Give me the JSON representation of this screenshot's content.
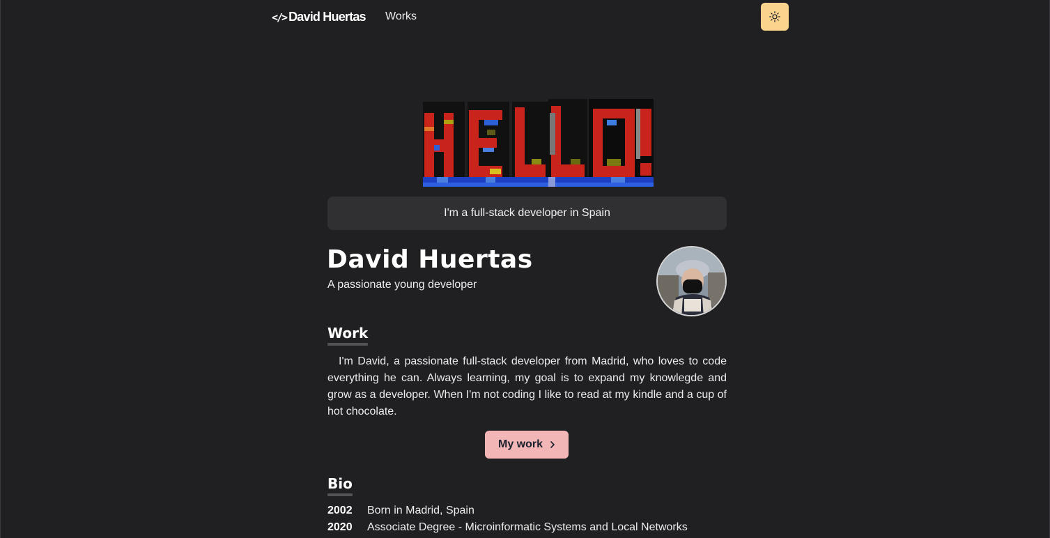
{
  "nav": {
    "logo_icon": "</>",
    "logo_text": "David Huertas",
    "links": [
      {
        "label": "Works"
      }
    ],
    "theme_toggle_icon": "sun-icon",
    "theme_toggle_color": "#fbd38d"
  },
  "hero": {
    "pixel_art_text": "HELLO!"
  },
  "tagline": "I'm a full-stack developer in Spain",
  "profile": {
    "name": "David Huertas",
    "subtitle": "A passionate young developer"
  },
  "work": {
    "heading": "Work",
    "paragraph": "I'm David, a passionate full-stack developer from Madrid, who loves to code everything he can. Always learning, my goal is to expand my knowlegde and grow as a developer. When I'm not coding I like to read at my kindle and a cup of hot chocolate.",
    "button_label": "My work",
    "button_icon": "chevron-right-icon",
    "button_color": "#f3b6b6"
  },
  "bio": {
    "heading": "Bio",
    "items": [
      {
        "year": "2002",
        "text": "Born in Madrid, Spain"
      },
      {
        "year": "2020",
        "text": "Associate Degree - Microinformatic Systems and Local Networks"
      }
    ]
  },
  "colors": {
    "background": "#202023",
    "surface": "#303033"
  }
}
